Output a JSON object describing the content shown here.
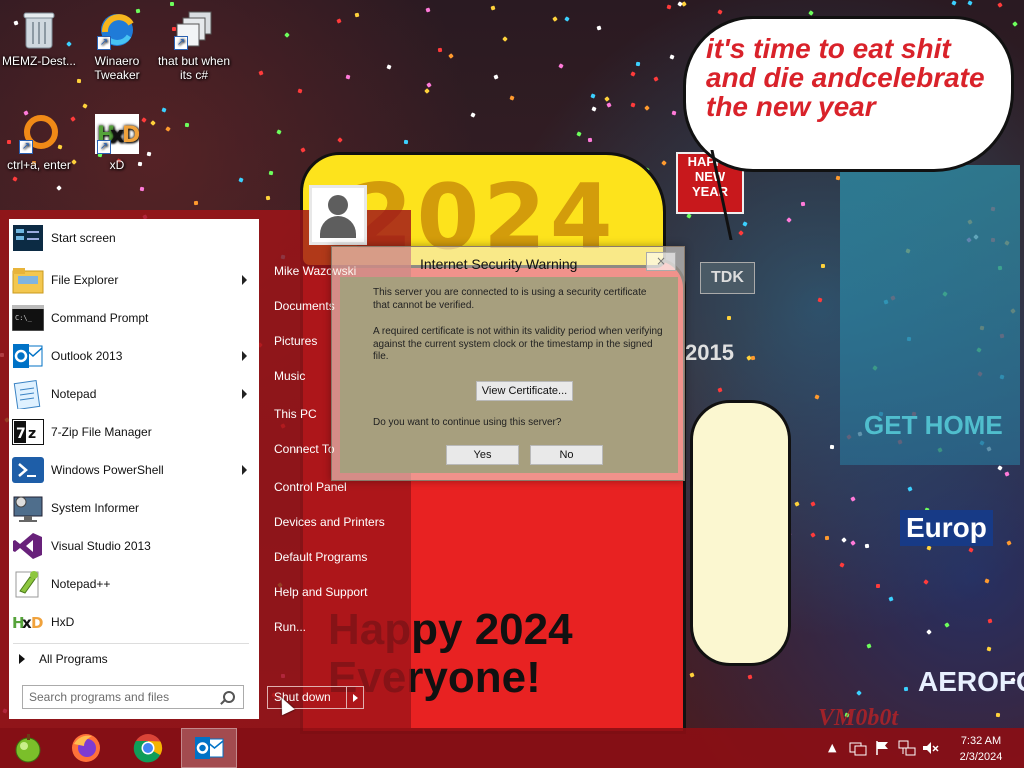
{
  "desktop": {
    "icons": [
      {
        "label": "MEMZ-Dest...",
        "icon": "recycle-bin-icon"
      },
      {
        "label": "Winaero Tweaker",
        "icon": "winaero-icon"
      },
      {
        "label": "that but when its c#",
        "icon": "stacked-windows-icon"
      },
      {
        "label": "ctrl+a, enter",
        "icon": "orange-ring-icon"
      },
      {
        "label": "xD",
        "icon": "hxd-icon"
      }
    ],
    "wallpaper": {
      "bubble_text": "it's time to eat shit and die andcelebrate the new year",
      "big_year": "2024",
      "happy_text": "Happy 2024 Everyone!",
      "sign_happy": "HAPPY NEW YEAR",
      "sign_tdk": "TDK",
      "sign_2015": "2015",
      "sign_gethome": "GET HOME",
      "sign_europe": "Europ",
      "sign_aerofos": "AEROFOS",
      "signature": "VM0b0t"
    }
  },
  "start_menu": {
    "programs": [
      {
        "label": "Start screen",
        "submenu": false
      },
      {
        "label": "File Explorer",
        "submenu": true
      },
      {
        "label": "Command Prompt",
        "submenu": false
      },
      {
        "label": "Outlook 2013",
        "submenu": true
      },
      {
        "label": "Notepad",
        "submenu": true
      },
      {
        "label": "7-Zip File Manager",
        "submenu": false
      },
      {
        "label": "Windows PowerShell",
        "submenu": true
      },
      {
        "label": "System Informer",
        "submenu": false
      },
      {
        "label": "Visual Studio 2013",
        "submenu": false
      },
      {
        "label": "Notepad++",
        "submenu": false
      },
      {
        "label": "HxD",
        "submenu": false
      }
    ],
    "all_programs": "All Programs",
    "search_placeholder": "Search programs and files",
    "user_name": "Mike Wazowski",
    "places": [
      "Documents",
      "Pictures",
      "Music",
      "This PC",
      "Connect To",
      "Control Panel",
      "Devices and Printers",
      "Default Programs",
      "Help and Support",
      "Run..."
    ],
    "shutdown_label": "Shut down"
  },
  "dialog": {
    "title": "Internet Security Warning",
    "close_glyph": "×",
    "para1": "This server you are connected to is using a security certificate that cannot be verified.",
    "para2": "A required certificate is not within its validity period when verifying against the current system clock or the timestamp in the signed file.",
    "view_cert": "View Certificate...",
    "question": "Do you want to continue using this server?",
    "yes": "Yes",
    "no": "No"
  },
  "taskbar": {
    "apps": [
      "start-orb-icon",
      "firefox-icon",
      "chrome-icon",
      "outlook-icon"
    ],
    "tray_chevron": "▲",
    "time": "7:32 AM",
    "date": "2/3/2024"
  }
}
